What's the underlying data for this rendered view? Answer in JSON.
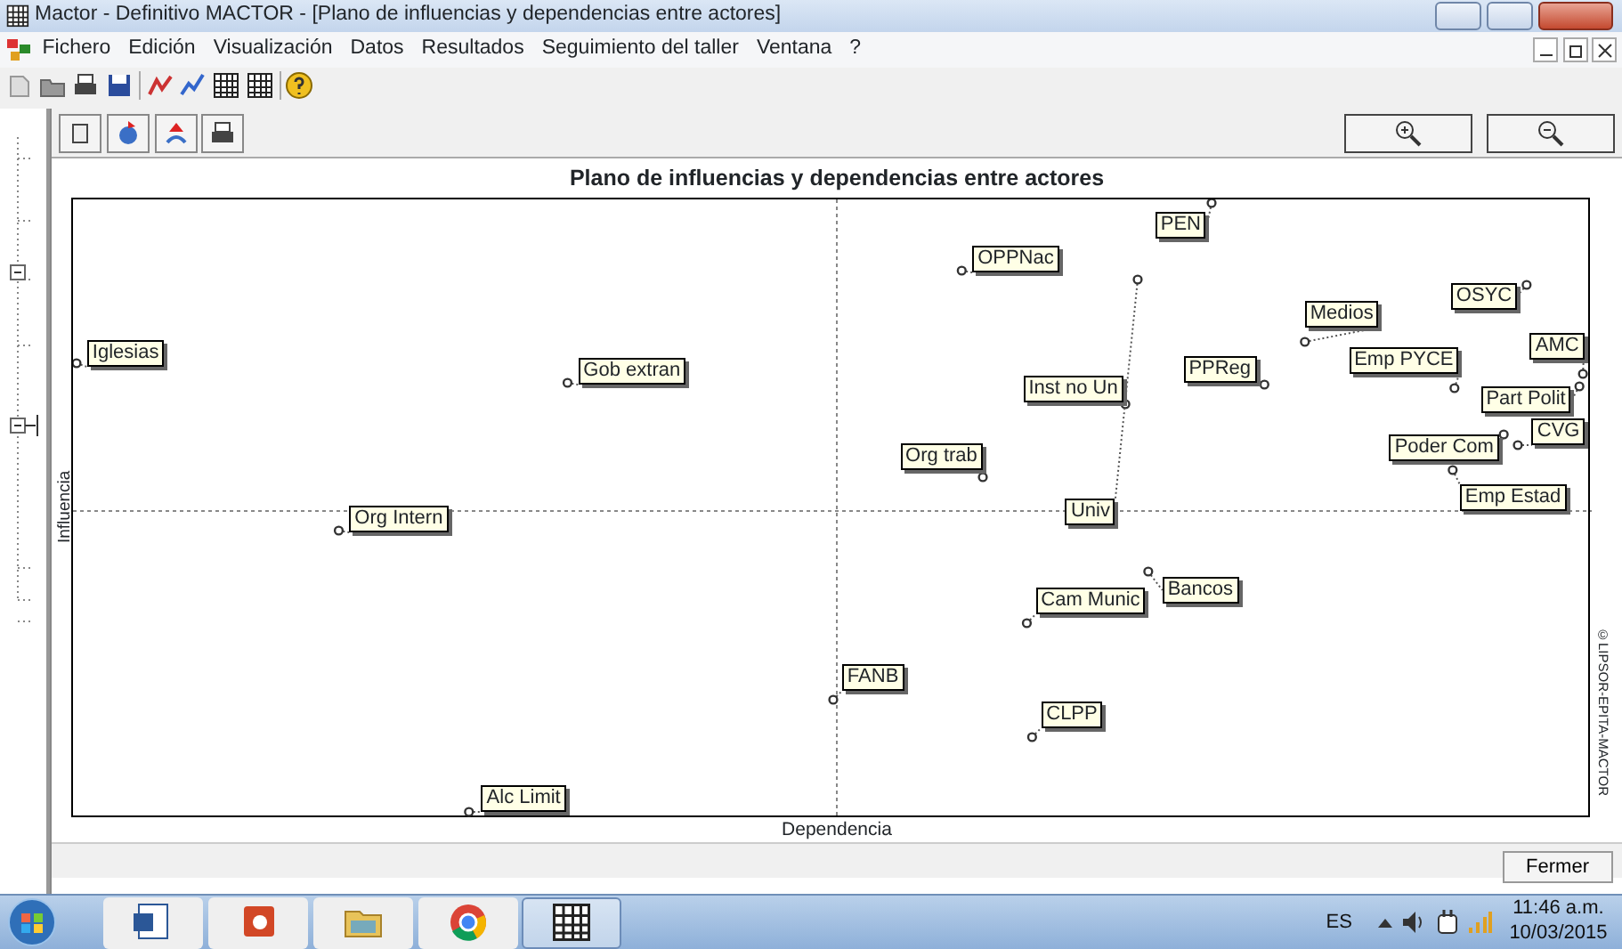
{
  "window": {
    "title": "Mactor  -  Definitivo MACTOR - [Plano de influencias y dependencias entre actores]"
  },
  "menu": [
    "Fichero",
    "Edición",
    "Visualización",
    "Datos",
    "Resultados",
    "Seguimiento del taller",
    "Ventana",
    "?"
  ],
  "chart_panel": {
    "title": "Plano de influencias y dependencias entre actores",
    "y_axis_label": "Influencia",
    "x_axis_label": "Dependencia",
    "credit": "©LIPSOR-EPITA-MACTOR",
    "actors": [
      {
        "label": "Iglesias"
      },
      {
        "label": "Gob extran"
      },
      {
        "label": "Org Intern"
      },
      {
        "label": "OPPNac"
      },
      {
        "label": "PEN"
      },
      {
        "label": "Inst no Un"
      },
      {
        "label": "Univ"
      },
      {
        "label": "Org trab"
      },
      {
        "label": "PPReg"
      },
      {
        "label": "Medios"
      },
      {
        "label": "Emp PYCE"
      },
      {
        "label": "OSYC"
      },
      {
        "label": "AMC"
      },
      {
        "label": "Part Polit"
      },
      {
        "label": "CVG"
      },
      {
        "label": "Poder Com"
      },
      {
        "label": "Emp Estad"
      },
      {
        "label": "Bancos"
      },
      {
        "label": "Cam Munic"
      },
      {
        "label": "FANB"
      },
      {
        "label": "CLPP"
      },
      {
        "label": "Alc Limit"
      }
    ]
  },
  "close_button": "Fermer",
  "taskbar": {
    "apps": [
      {
        "kind": "document",
        "selected": false
      },
      {
        "kind": "presentation",
        "selected": false
      },
      {
        "kind": "folder",
        "selected": false
      },
      {
        "kind": "circle",
        "selected": false
      },
      {
        "kind": "grid",
        "selected": true
      }
    ],
    "language": "ES",
    "time": "11:46 a.m.",
    "date": "10/03/2015"
  }
}
